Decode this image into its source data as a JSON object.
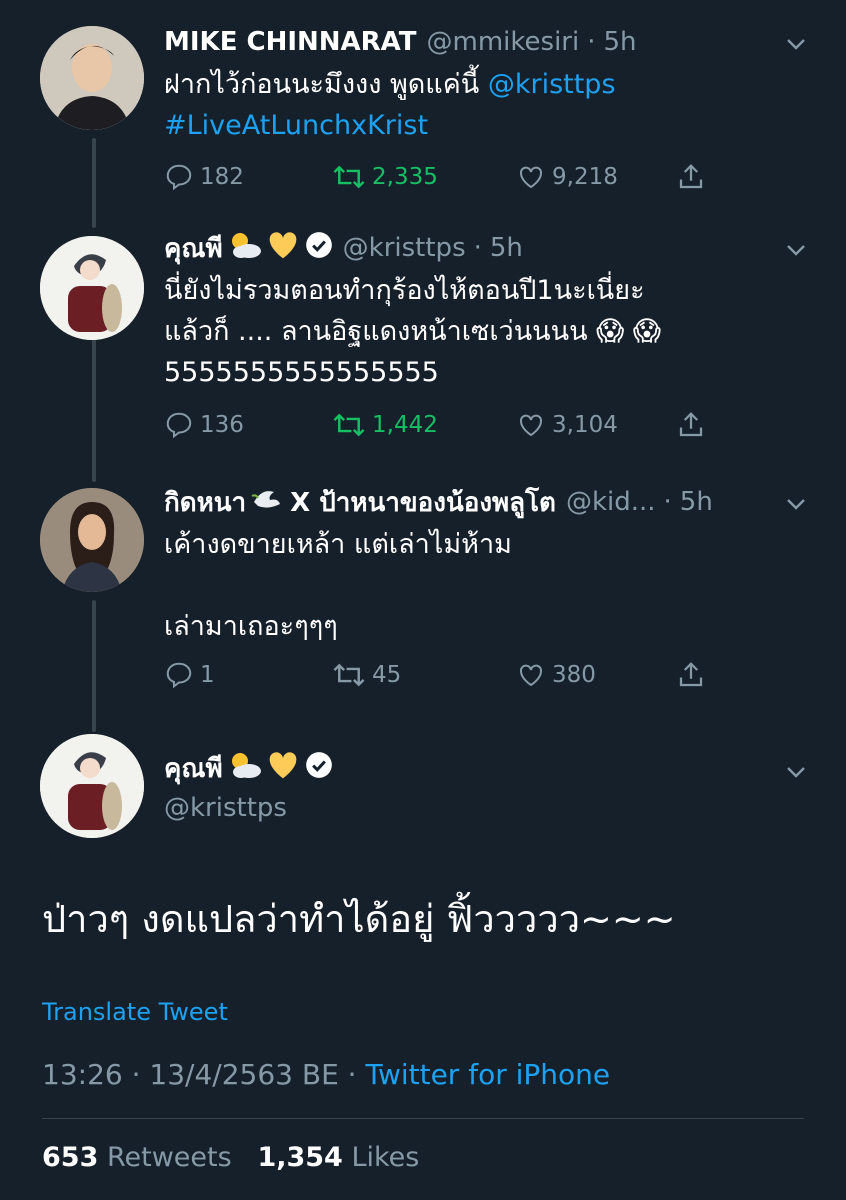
{
  "tweets": [
    {
      "name": "MIKE CHINNARAT",
      "emoji": "",
      "verified": false,
      "handle": "@mmikesiri",
      "time": "5h",
      "text_lines": [
        "ฝากไว้ก่อนนะมึงงง พูดแค่นี้ "
      ],
      "mention": "@kristtps",
      "hashtag": "#LiveAtLunchxKrist",
      "replies": "182",
      "retweets": "2,335",
      "likes": "9,218",
      "retweeted": true
    },
    {
      "name": "คุณพี",
      "verified": true,
      "handle": "@kristtps",
      "time": "5h",
      "text": "นี่ยังไม่รวมตอนทำกุร้องไห้ตอนปี1นะเนี่ยะ\nแล้วก็ .... ลานอิฐแดงหน้าเซเว่นนนน 😱 😱\n5555555555555555",
      "replies": "136",
      "retweets": "1,442",
      "likes": "3,104",
      "retweeted": true
    },
    {
      "name": "กิดหนา",
      "name_suffix": "X ป้าหนาของน้องพลูโต",
      "handle": "@kid...",
      "time": "5h",
      "text": "เค้างดขายเหล้า แต่เล่าไม่ห้าม\n\nเล่ามาเถอะๆๆๆ",
      "replies": "1",
      "retweets": "45",
      "likes": "380",
      "retweeted": false
    }
  ],
  "main": {
    "name": "คุณพี",
    "handle": "@kristtps",
    "text": "ป่าวๆ งดแปลว่าทำได้อยู่ ฟิ้ววววว~~~",
    "translate": "Translate Tweet",
    "timestamp": "13:26 · 13/4/2563 BE · ",
    "source": "Twitter for iPhone",
    "retweet_count": "653",
    "retweet_label": "Retweets",
    "like_count": "1,354",
    "like_label": "Likes"
  },
  "colors": {
    "bg": "#15202b",
    "link": "#1da1f2",
    "muted": "#8899a6",
    "retweet": "#17bf63"
  }
}
